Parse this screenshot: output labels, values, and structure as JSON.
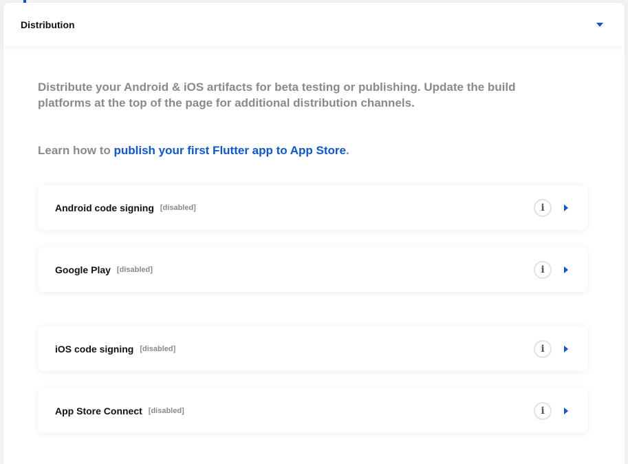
{
  "panel": {
    "title": "Distribution"
  },
  "intro": {
    "text": "Distribute your Android & iOS artifacts for beta testing or publishing. Update the build platforms at the top of the page for additional distribution channels."
  },
  "learn": {
    "prefix": "Learn how to ",
    "link": "publish your first Flutter app to App Store",
    "suffix": "."
  },
  "cards": [
    {
      "title": "Android code signing",
      "status": "[disabled]"
    },
    {
      "title": "Google Play",
      "status": "[disabled]"
    },
    {
      "title": "iOS code signing",
      "status": "[disabled]"
    },
    {
      "title": "App Store Connect",
      "status": "[disabled]"
    }
  ],
  "icons": {
    "info": "i",
    "accent": "#0b56d9"
  }
}
